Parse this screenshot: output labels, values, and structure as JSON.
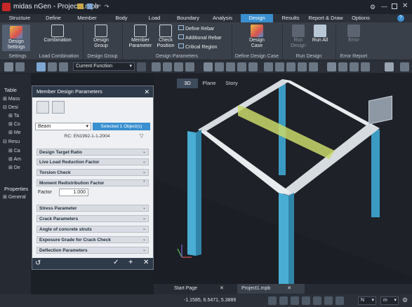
{
  "app": {
    "title": "midas nGen - Project1.mpb"
  },
  "menu": [
    "Structure",
    "Define",
    "Member",
    "Body",
    "Load",
    "Boundary",
    "Analysis",
    "Design",
    "Results",
    "Report & Draw",
    "Options"
  ],
  "menu_active": "Design",
  "ribbon": {
    "design_settings": "Design Settings",
    "combination": "Combination",
    "design_group": "Design Group",
    "member_parameter": "Member Parameter",
    "check_position": "Check Position",
    "define_rebar": "Define Rebar",
    "additional_rebar": "Additional Rebar",
    "critical_region": "Critical Region",
    "design_case": "Design Case",
    "run_design": "Run Design",
    "run_all": "Run All",
    "error": "Error",
    "groups": [
      "Settings",
      "Load Combination",
      "Design Group",
      "Design Parameters",
      "Define Design Case",
      "Run Design",
      "Error Report"
    ]
  },
  "toolbar": {
    "function_select": "Current Function"
  },
  "left_panel": {
    "table_label": "Table",
    "tree": [
      "Mass",
      "Desi",
      "Ta",
      "Co",
      "Me",
      "Resu",
      "Ca",
      "Am",
      "De"
    ],
    "properties_label": "Properties",
    "general_label": "General"
  },
  "dialog": {
    "title": "Member Design Parameters",
    "type_value": "Beam",
    "selected_button": "Selected 1 Object(s)",
    "code": "RC: EN1992-1-1-2004",
    "sections": {
      "s1": "Design Target Ratio",
      "s2": "Live Load Reduction Factor",
      "s3": "Torsion Check",
      "s4": "Moment Redistribution Factor",
      "s5": "Stress Parameter",
      "s6": "Crack Parameters",
      "s7": "Angle of concrete struts",
      "s8": "Exposure Grade for Crack Check",
      "s9": "Deflection Parameters"
    },
    "factor_label": "Factor",
    "factor_value": "1.000"
  },
  "view_tabs": [
    "3D",
    "Plane",
    "Story"
  ],
  "doc_tabs": [
    "Start Page",
    "Project1.mpb"
  ],
  "status": {
    "coords": "-1.1585, 6.5471, 5.3886",
    "unit_force": "N",
    "unit_length": "m"
  },
  "colors": {
    "accent": "#3a8fd0",
    "column": "#4aaed4",
    "beam": "#e8ecef",
    "selected": "#d8e68a"
  }
}
